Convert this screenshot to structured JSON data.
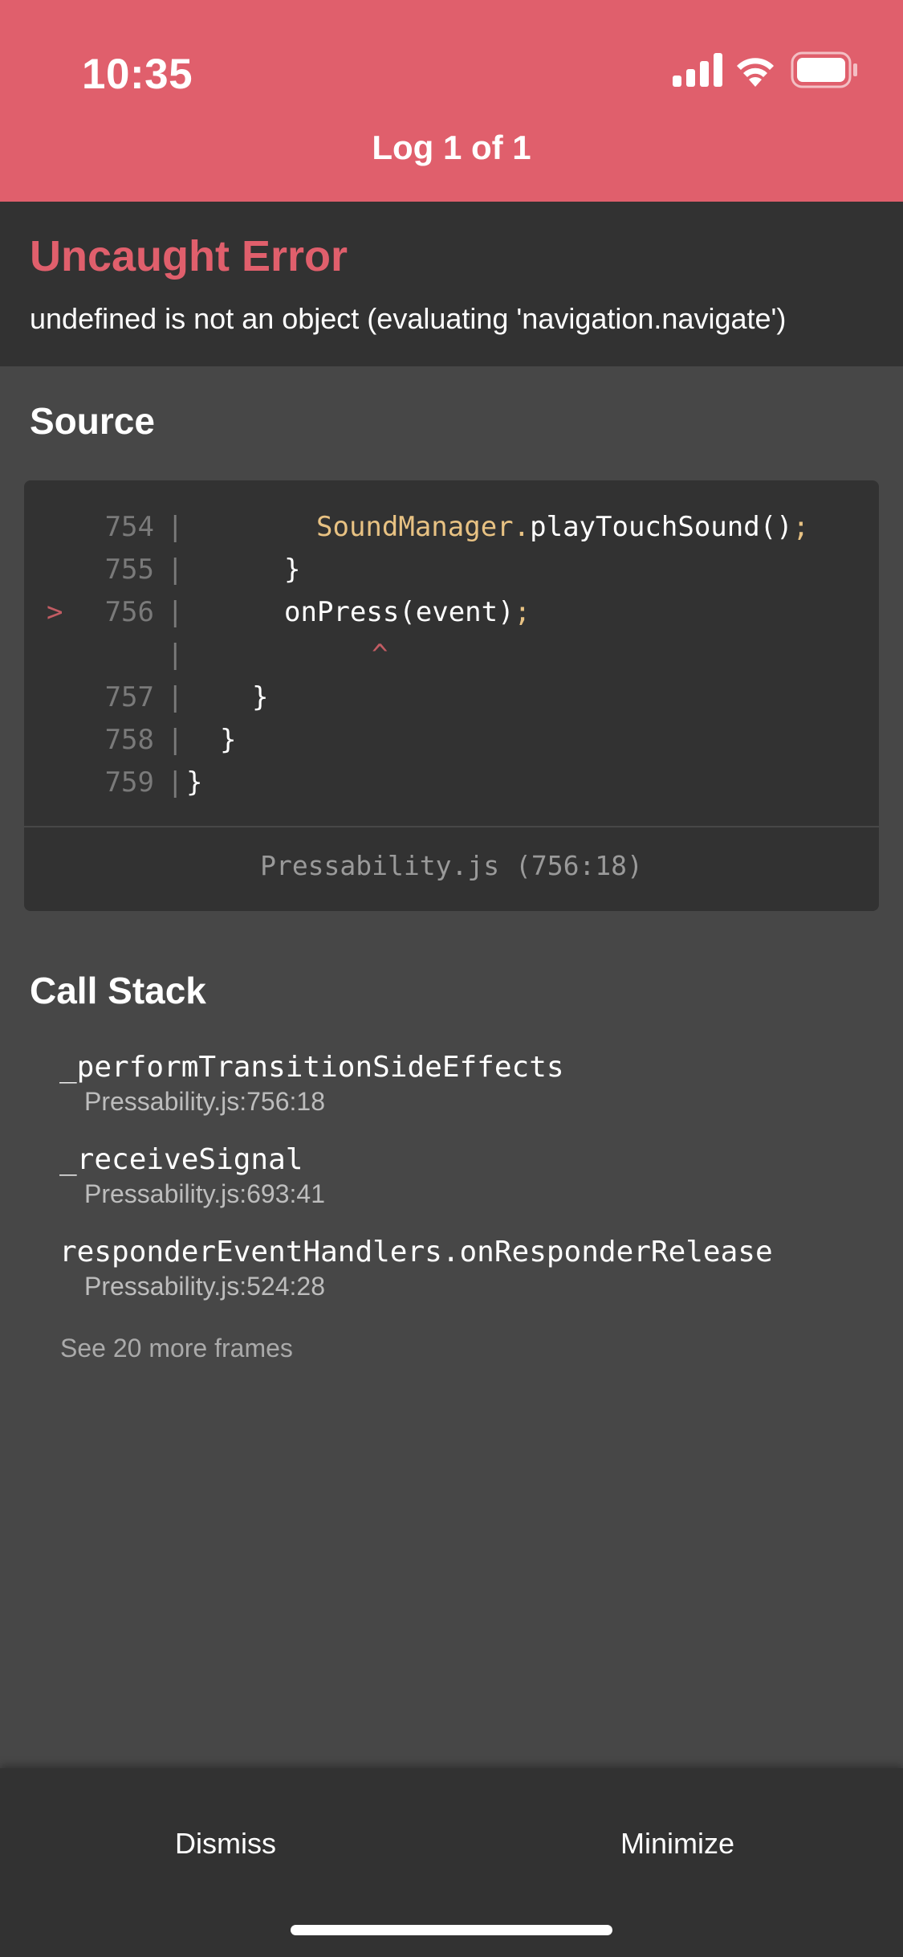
{
  "status_bar": {
    "time": "10:35"
  },
  "header": {
    "title": "Log 1 of 1",
    "color": "#E05F6C"
  },
  "error": {
    "title": "Uncaught Error",
    "message": "undefined is not an object (evaluating 'navigation.navigate')"
  },
  "source": {
    "section_title": "Source",
    "lines": [
      {
        "marker": "",
        "number": "754",
        "parts": [
          {
            "text": "SoundManager",
            "tone": "yellow"
          },
          {
            "text": ".",
            "tone": "yellow"
          },
          {
            "text": "playTouchSound()",
            "tone": "white"
          },
          {
            "text": ";",
            "tone": "yellow"
          }
        ]
      },
      {
        "marker": "",
        "number": "755",
        "parts": [
          {
            "text": "}",
            "tone": "white"
          }
        ]
      },
      {
        "marker": ">",
        "number": "756",
        "parts": [
          {
            "text": "onPress(event)",
            "tone": "white"
          },
          {
            "text": ";",
            "tone": "yellow"
          }
        ]
      },
      {
        "marker": "",
        "number": "",
        "parts": [
          {
            "text": "^",
            "tone": "red"
          }
        ]
      },
      {
        "marker": "",
        "number": "757",
        "parts": [
          {
            "text": "}",
            "tone": "white"
          }
        ]
      },
      {
        "marker": "",
        "number": "758",
        "parts": [
          {
            "text": "}",
            "tone": "white"
          }
        ]
      },
      {
        "marker": "",
        "number": "759",
        "parts": [
          {
            "text": "}",
            "tone": "white"
          }
        ]
      }
    ],
    "file_location": "Pressability.js (756:18)"
  },
  "call_stack": {
    "section_title": "Call Stack",
    "frames": [
      {
        "name": "_performTransitionSideEffects",
        "location": "Pressability.js:756:18"
      },
      {
        "name": "_receiveSignal",
        "location": "Pressability.js:693:41"
      },
      {
        "name": "responderEventHandlers.onResponderRelease",
        "location": "Pressability.js:524:28"
      }
    ],
    "more_frames": "See 20 more frames"
  },
  "footer": {
    "dismiss_label": "Dismiss",
    "minimize_label": "Minimize"
  }
}
